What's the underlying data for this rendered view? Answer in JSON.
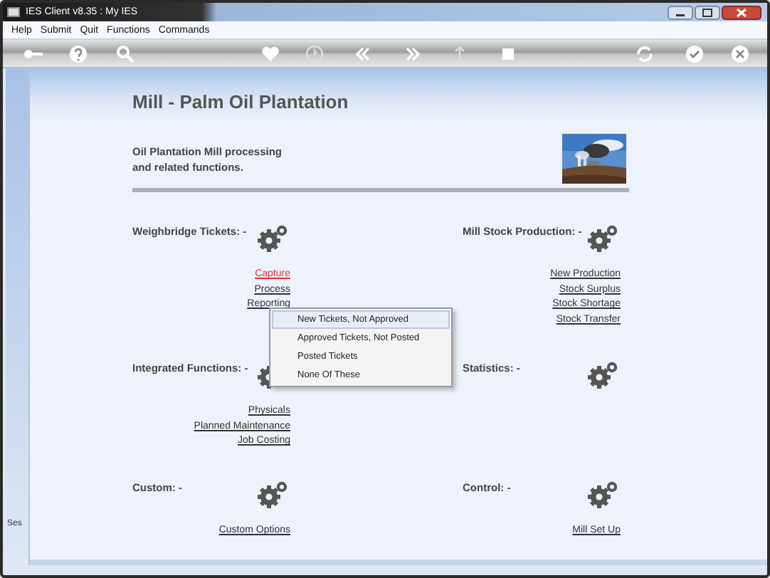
{
  "window": {
    "title": "IES Client v8.35 : My IES"
  },
  "menu": [
    "Help",
    "Submit",
    "Quit",
    "Functions",
    "Commands"
  ],
  "side_panel": {
    "label": "Ses"
  },
  "page": {
    "title": "Mill - Palm Oil Plantation",
    "description": [
      "Oil Plantation Mill processing",
      "and related functions."
    ]
  },
  "sections": [
    {
      "label": "Weighbridge Tickets: -",
      "links": [
        {
          "label": "Capture",
          "highlighted": true
        },
        {
          "label": "Process",
          "highlighted": false
        },
        {
          "label": "Reporting",
          "highlighted": false
        }
      ]
    },
    {
      "label": "Mill Stock Production: -",
      "links": [
        {
          "label": "New Production",
          "highlighted": false
        },
        {
          "label": "Stock Surplus",
          "highlighted": false
        },
        {
          "label": "Stock Shortage",
          "highlighted": false
        },
        {
          "label": "Stock Transfer",
          "highlighted": false
        }
      ]
    },
    {
      "label": "Integrated Functions: -",
      "links": [
        {
          "label": "Physicals",
          "highlighted": false
        },
        {
          "label": "Planned Maintenance",
          "highlighted": false
        },
        {
          "label": "Job Costing",
          "highlighted": false
        }
      ]
    },
    {
      "label": "Statistics: -"
    },
    {
      "label": "Custom: -",
      "links": [
        {
          "label": "Custom Options",
          "highlighted": false
        }
      ]
    },
    {
      "label": "Control: -",
      "links": [
        {
          "label": "Mill Set Up",
          "highlighted": false
        }
      ]
    }
  ],
  "popup_menu": {
    "items": [
      {
        "label": "New Tickets, Not Approved",
        "selected": true
      },
      {
        "label": "Approved Tickets, Not Posted",
        "selected": false
      },
      {
        "label": "Posted Tickets",
        "selected": false
      },
      {
        "label": "None Of These",
        "selected": false
      }
    ]
  }
}
